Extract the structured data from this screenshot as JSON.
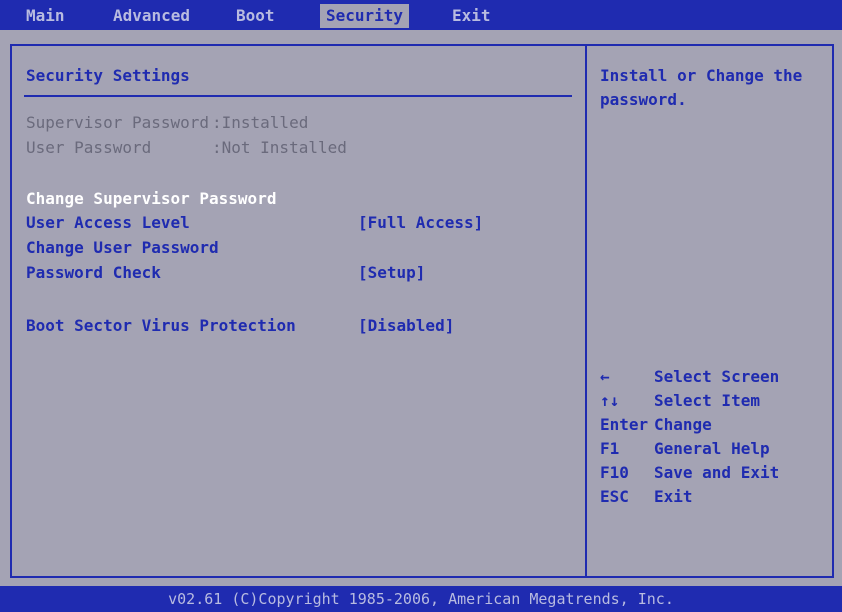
{
  "menu": {
    "tabs": [
      "Main",
      "Advanced",
      "Boot",
      "Security",
      "Exit"
    ],
    "active": "Security"
  },
  "section": {
    "title": "Security Settings"
  },
  "status": {
    "supervisor_label": "Supervisor Password",
    "supervisor_value": ":Installed",
    "user_label": "User Password",
    "user_value": ":Not Installed"
  },
  "items": {
    "change_supervisor": "Change Supervisor Password",
    "user_access_label": "User Access Level",
    "user_access_value": "[Full Access]",
    "change_user": "Change User Password",
    "password_check_label": "Password Check",
    "password_check_value": "[Setup]",
    "boot_virus_label": "Boot Sector Virus Protection",
    "boot_virus_value": "[Disabled]"
  },
  "help": {
    "line1": "Install or Change the",
    "line2": "password."
  },
  "keys": [
    {
      "key": "←",
      "action": "Select Screen"
    },
    {
      "key": "↑↓",
      "action": "Select Item"
    },
    {
      "key": "Enter",
      "action": "Change"
    },
    {
      "key": "F1",
      "action": "General Help"
    },
    {
      "key": "F10",
      "action": "Save and Exit"
    },
    {
      "key": "ESC",
      "action": "Exit"
    }
  ],
  "footer": {
    "text": "v02.61 (C)Copyright 1985-2006, American Megatrends, Inc."
  },
  "colors": {
    "bios_blue": "#1f2bb0",
    "bios_gray": "#a4a3b4",
    "highlight": "#ffffff"
  }
}
